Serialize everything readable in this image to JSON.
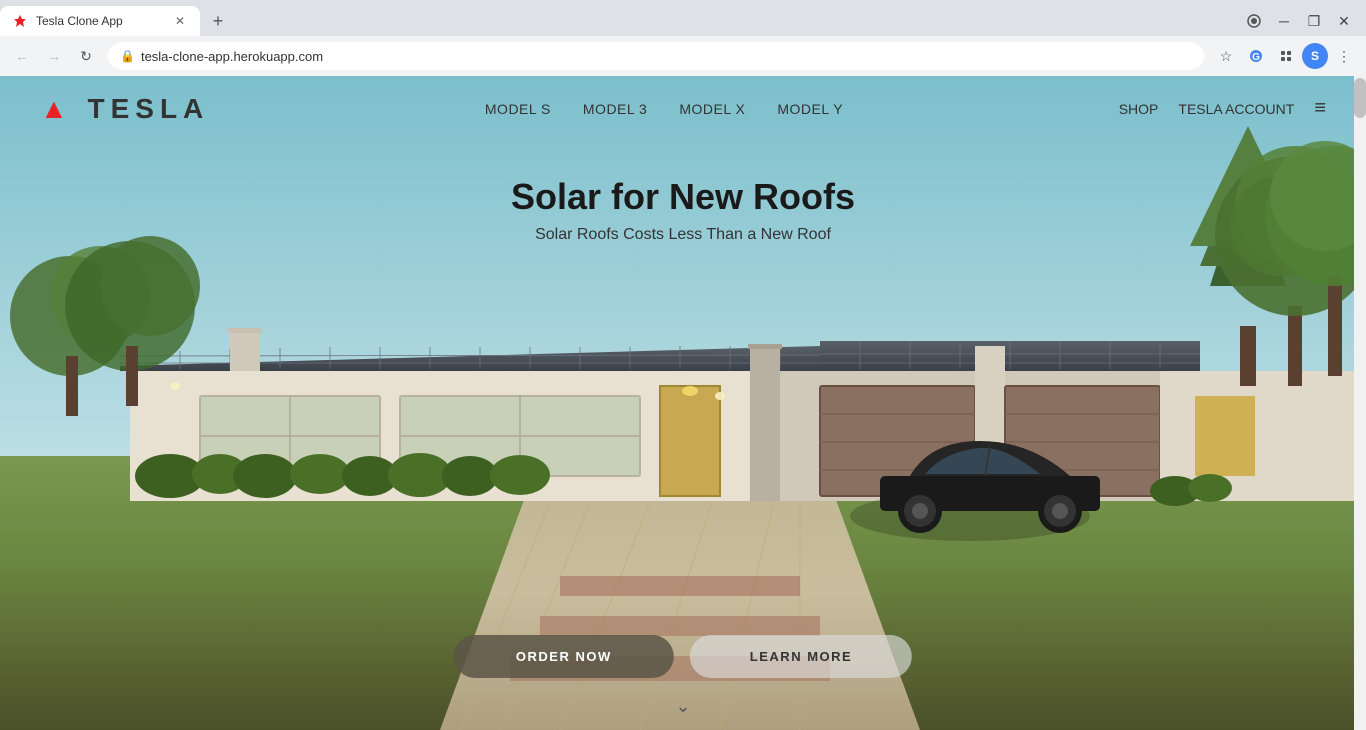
{
  "browser": {
    "tab_title": "Tesla Clone App",
    "url": "tesla-clone-app.herokuapp.com",
    "favicon": "T",
    "new_tab_label": "+",
    "nav": {
      "back_disabled": true,
      "forward_disabled": true
    },
    "window_controls": {
      "record": "⏺",
      "minimize": "─",
      "maximize": "❐",
      "close": "✕"
    }
  },
  "tesla": {
    "logo_text": "TESLA",
    "nav_links": [
      {
        "label": "MODEL S"
      },
      {
        "label": "MODEL 3"
      },
      {
        "label": "MODEL X"
      },
      {
        "label": "MODEL Y"
      }
    ],
    "nav_right_links": [
      {
        "label": "SHOP"
      },
      {
        "label": "TESLA ACCOUNT"
      },
      {
        "label": "≡"
      }
    ],
    "hero": {
      "title": "Solar for New Roofs",
      "subtitle": "Solar Roofs Costs Less Than a New Roof"
    },
    "cta": {
      "order_label": "ORDER NOW",
      "learn_label": "LEARN MORE"
    },
    "scroll_indicator": "⌄"
  }
}
